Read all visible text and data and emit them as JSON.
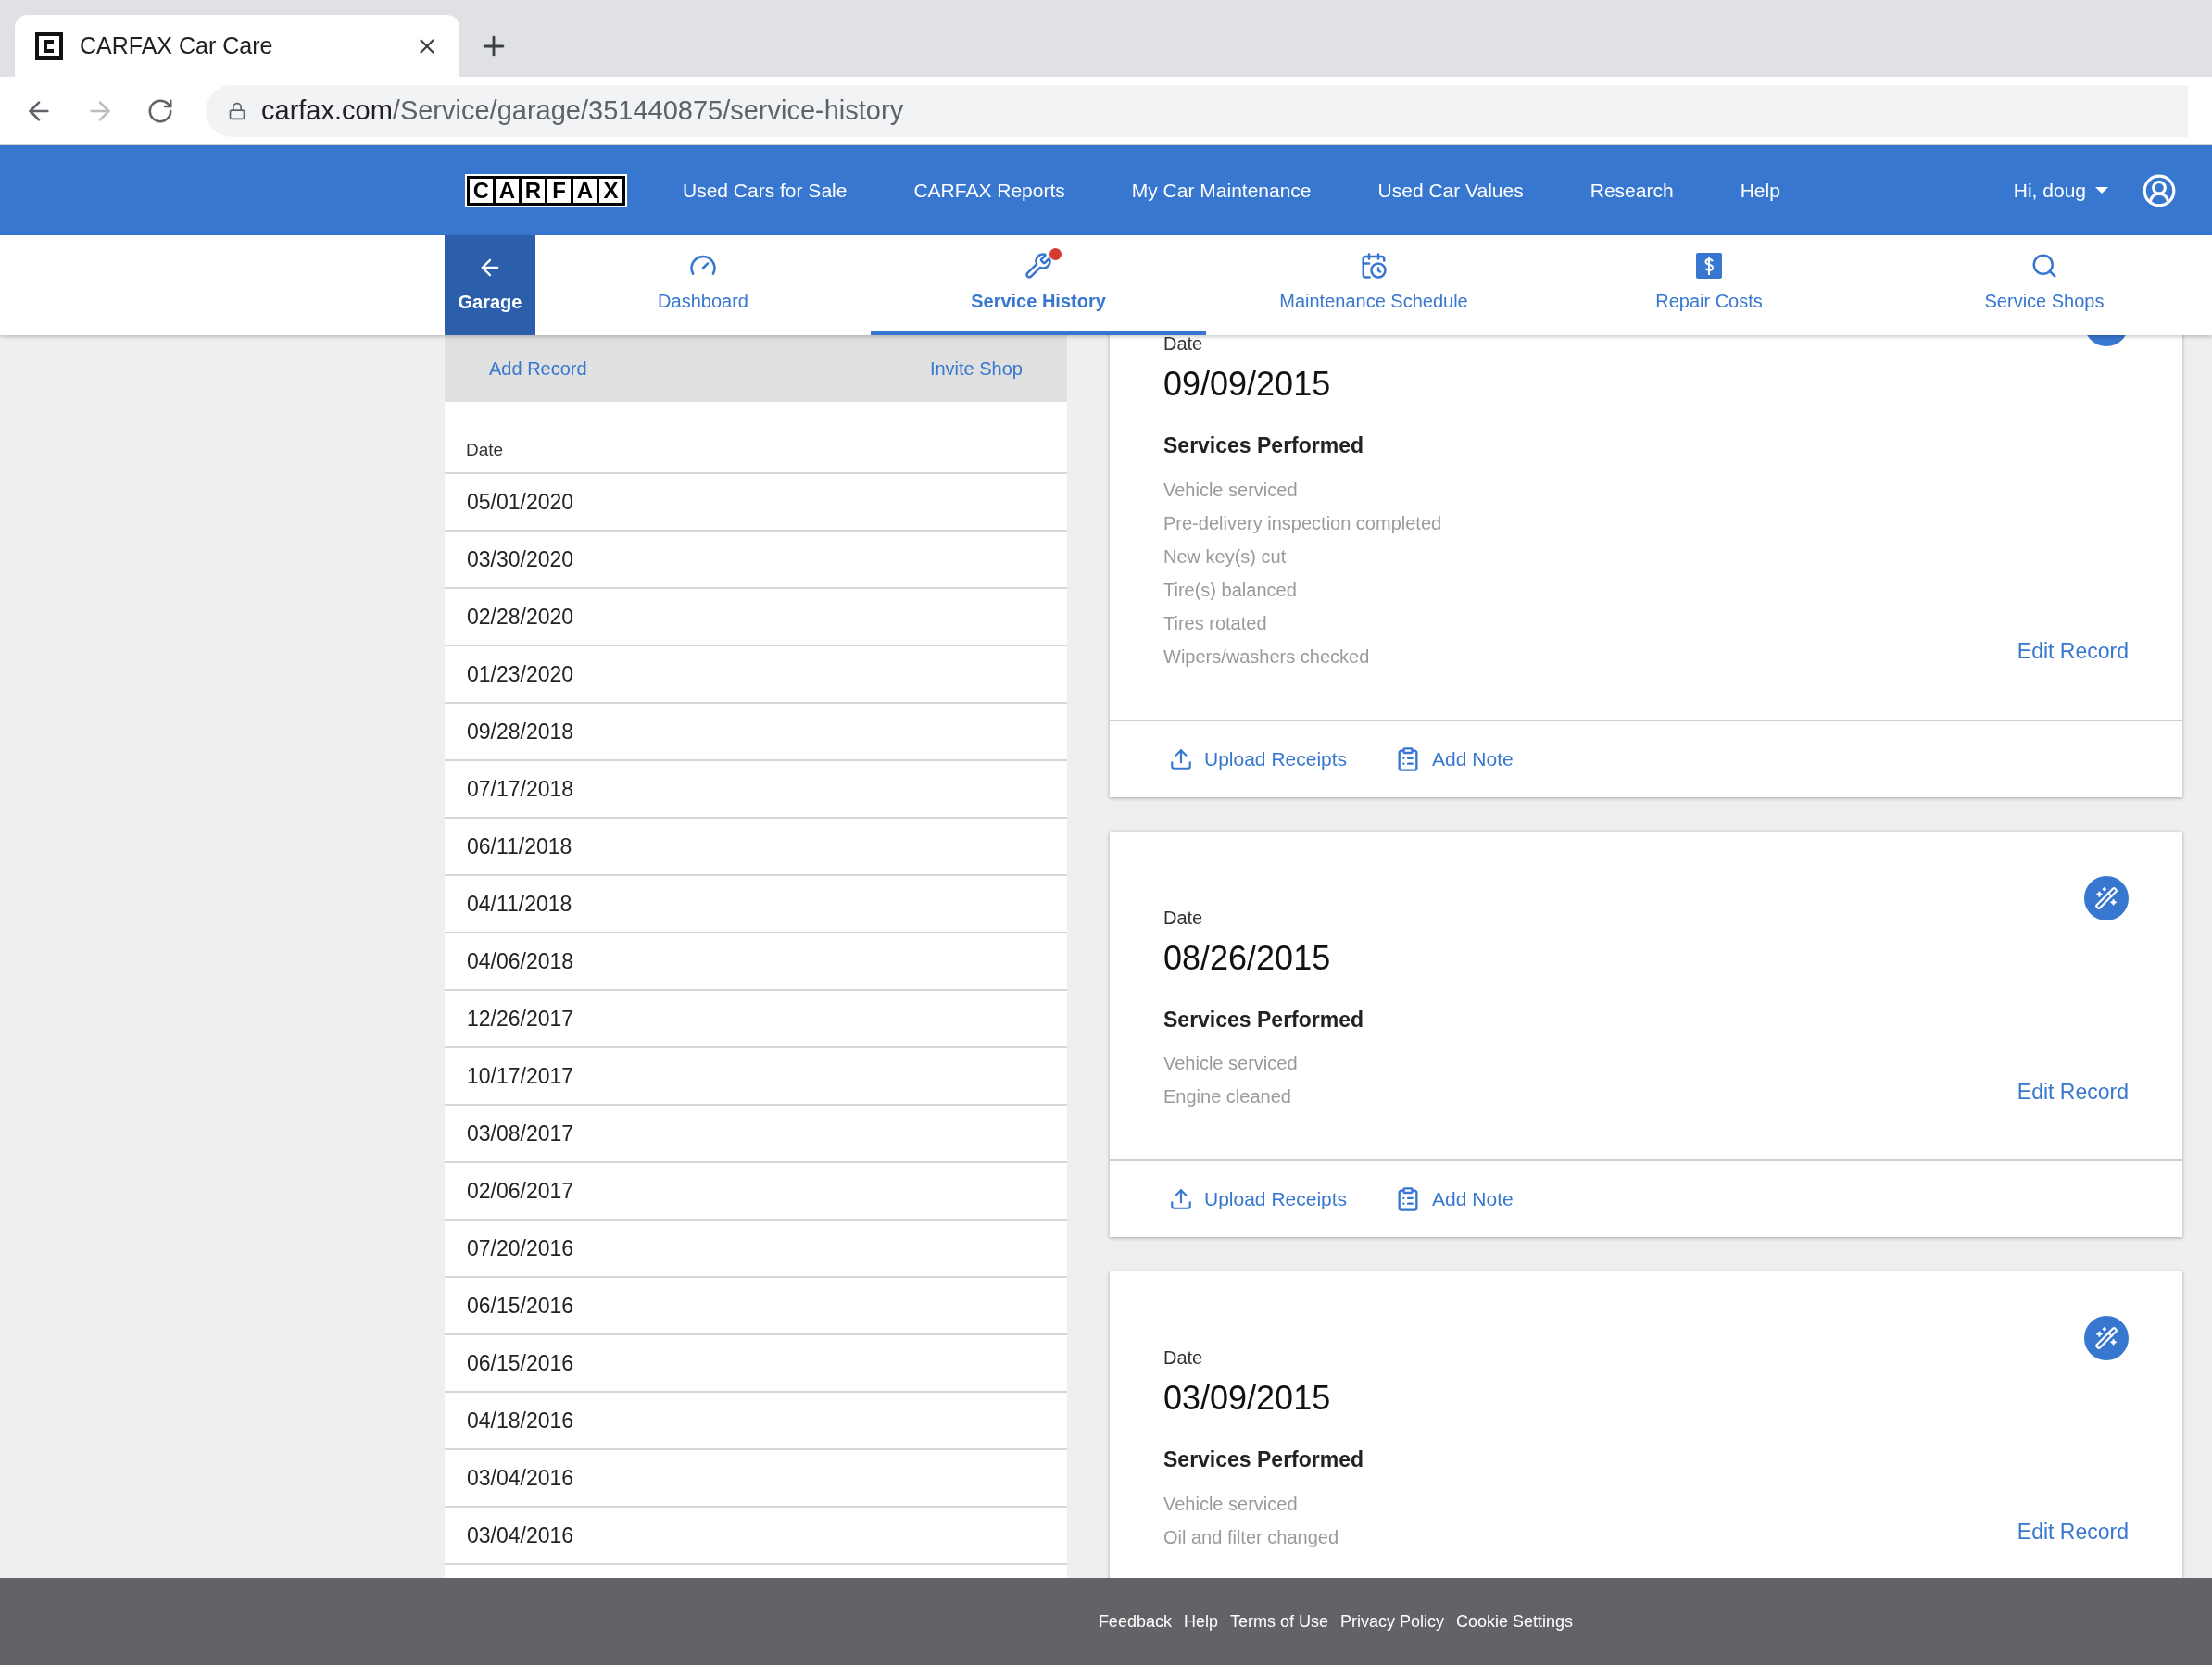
{
  "browser": {
    "tab_title": "CARFAX Car Care",
    "url_domain": "carfax.com",
    "url_path": "/Service/garage/351440875/service-history"
  },
  "logo": [
    "C",
    "A",
    "R",
    "F",
    "A",
    "X"
  ],
  "top_nav": [
    "Used Cars for Sale",
    "CARFAX Reports",
    "My Car Maintenance",
    "Used Car Values",
    "Research",
    "Help"
  ],
  "user": {
    "greeting": "Hi, doug"
  },
  "back": {
    "label": "Garage"
  },
  "sub_nav": [
    {
      "label": "Dashboard",
      "kind": "gauge",
      "selected": false,
      "alert": false
    },
    {
      "label": "Service History",
      "kind": "tools",
      "selected": true,
      "alert": true
    },
    {
      "label": "Maintenance Schedule",
      "kind": "schedule",
      "selected": false,
      "alert": false
    },
    {
      "label": "Repair Costs",
      "kind": "dollar",
      "selected": false,
      "alert": false
    },
    {
      "label": "Service Shops",
      "kind": "search",
      "selected": false,
      "alert": false
    }
  ],
  "sidebar": {
    "actions": [
      "Add Record",
      "Invite Shop"
    ],
    "column": "Date",
    "rows": [
      "05/01/2020",
      "03/30/2020",
      "02/28/2020",
      "01/23/2020",
      "09/28/2018",
      "07/17/2018",
      "06/11/2018",
      "04/11/2018",
      "04/06/2018",
      "12/26/2017",
      "10/17/2017",
      "03/08/2017",
      "02/06/2017",
      "07/20/2016",
      "06/15/2016",
      "06/15/2016",
      "04/18/2016",
      "03/04/2016",
      "03/04/2016"
    ]
  },
  "records": [
    {
      "date_label": "Date",
      "date": "09/09/2015",
      "services_title": "Services Performed",
      "services": [
        "Vehicle serviced",
        "Pre-delivery inspection completed",
        "New key(s) cut",
        "Tire(s) balanced",
        "Tires rotated",
        "Wipers/washers checked"
      ],
      "edit": "Edit Record",
      "actions": [
        "Upload Receipts",
        "Add Note"
      ]
    },
    {
      "date_label": "Date",
      "date": "08/26/2015",
      "services_title": "Services Performed",
      "services": [
        "Vehicle serviced",
        "Engine cleaned"
      ],
      "edit": "Edit Record",
      "actions": [
        "Upload Receipts",
        "Add Note"
      ]
    },
    {
      "date_label": "Date",
      "date": "03/09/2015",
      "services_title": "Services Performed",
      "services": [
        "Vehicle serviced",
        "Oil and filter changed"
      ],
      "edit": "Edit Record"
    }
  ],
  "footer": [
    "Feedback",
    "Help",
    "Terms of Use",
    "Privacy Policy",
    "Cookie Settings"
  ]
}
